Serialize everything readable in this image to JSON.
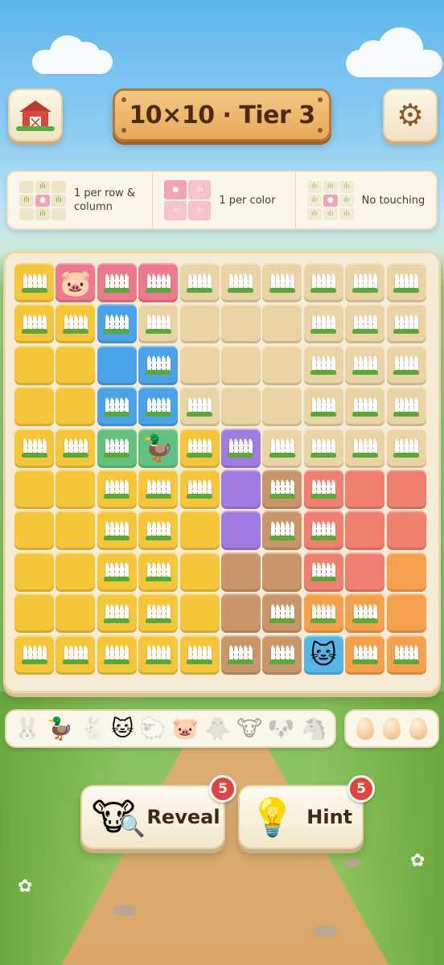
{
  "header": {
    "title": "10×10 · Tier 3",
    "home_icon": "barn-icon",
    "settings_icon": "gear-icon"
  },
  "rules": [
    {
      "text": "1 per row & column",
      "icon": "rows-columns-icon"
    },
    {
      "text": "1 per color",
      "icon": "color-region-icon"
    },
    {
      "text": "No touching",
      "icon": "no-touching-icon"
    }
  ],
  "board": {
    "size": 10,
    "palette": {
      "Y": "#f6c63a",
      "P": "#ec7a8c",
      "B": "#4aa3e8",
      "T": "#ead3a4",
      "G": "#64c07e",
      "V": "#a07be0",
      "K": "#c9966c",
      "R": "#ef7f6e",
      "O": "#f5a04c",
      "C": "#56b6e8"
    },
    "rows": [
      [
        "Y",
        "P",
        "P",
        "P",
        "T",
        "T",
        "T",
        "T",
        "T",
        "T"
      ],
      [
        "Y",
        "Y",
        "B",
        "T",
        "T",
        "T",
        "T",
        "T",
        "T",
        "T"
      ],
      [
        "Y",
        "Y",
        "B",
        "B",
        "T",
        "T",
        "T",
        "T",
        "T",
        "T"
      ],
      [
        "Y",
        "Y",
        "B",
        "B",
        "T",
        "T",
        "T",
        "T",
        "T",
        "T"
      ],
      [
        "Y",
        "Y",
        "G",
        "G",
        "Y",
        "V",
        "T",
        "T",
        "T",
        "T"
      ],
      [
        "Y",
        "Y",
        "Y",
        "Y",
        "Y",
        "V",
        "K",
        "R",
        "R",
        "R"
      ],
      [
        "Y",
        "Y",
        "Y",
        "Y",
        "Y",
        "V",
        "K",
        "R",
        "R",
        "R"
      ],
      [
        "Y",
        "Y",
        "Y",
        "Y",
        "Y",
        "K",
        "K",
        "R",
        "R",
        "O"
      ],
      [
        "Y",
        "Y",
        "Y",
        "Y",
        "Y",
        "K",
        "K",
        "O",
        "O",
        "O"
      ],
      [
        "Y",
        "Y",
        "Y",
        "Y",
        "Y",
        "K",
        "K",
        "C",
        "O",
        "O"
      ]
    ],
    "fences": [
      [
        1,
        0,
        1,
        1,
        1,
        1,
        1,
        1,
        1,
        1
      ],
      [
        1,
        1,
        1,
        1,
        0,
        0,
        0,
        1,
        1,
        1
      ],
      [
        0,
        0,
        0,
        1,
        0,
        0,
        0,
        1,
        1,
        1
      ],
      [
        0,
        0,
        1,
        1,
        1,
        0,
        0,
        1,
        1,
        1
      ],
      [
        1,
        1,
        1,
        0,
        1,
        1,
        1,
        1,
        1,
        1
      ],
      [
        0,
        0,
        1,
        1,
        1,
        0,
        1,
        1,
        0,
        0
      ],
      [
        0,
        0,
        1,
        1,
        0,
        0,
        1,
        1,
        0,
        0
      ],
      [
        0,
        0,
        1,
        1,
        0,
        0,
        0,
        1,
        0,
        0
      ],
      [
        0,
        0,
        1,
        1,
        0,
        0,
        1,
        1,
        1,
        0
      ],
      [
        1,
        1,
        1,
        1,
        1,
        1,
        1,
        0,
        1,
        1
      ]
    ],
    "animals": [
      {
        "row": 0,
        "col": 1,
        "animal": "pig",
        "glyph": "🐷"
      },
      {
        "row": 4,
        "col": 3,
        "animal": "duck",
        "glyph": "🦆"
      },
      {
        "row": 9,
        "col": 7,
        "animal": "cat",
        "glyph": "🐱"
      }
    ]
  },
  "tray": {
    "animals": [
      {
        "name": "rabbit",
        "glyph": "🐰",
        "found": false
      },
      {
        "name": "duck",
        "glyph": "🦆",
        "found": true
      },
      {
        "name": "rabbit",
        "glyph": "🐇",
        "found": false
      },
      {
        "name": "cat",
        "glyph": "🐱",
        "found": true
      },
      {
        "name": "sheep",
        "glyph": "🐑",
        "found": false
      },
      {
        "name": "pig",
        "glyph": "🐷",
        "found": true
      },
      {
        "name": "chick",
        "glyph": "🐥",
        "found": false
      },
      {
        "name": "cow",
        "glyph": "🐮",
        "found": false
      },
      {
        "name": "dog",
        "glyph": "🐶",
        "found": false
      },
      {
        "name": "horse",
        "glyph": "🐴",
        "found": false
      }
    ],
    "eggs": 3
  },
  "actions": {
    "reveal": {
      "label": "Reveal",
      "count": "5",
      "icon": "cow-magnifier-icon"
    },
    "hint": {
      "label": "Hint",
      "count": "5",
      "icon": "lightbulb-icon"
    }
  }
}
